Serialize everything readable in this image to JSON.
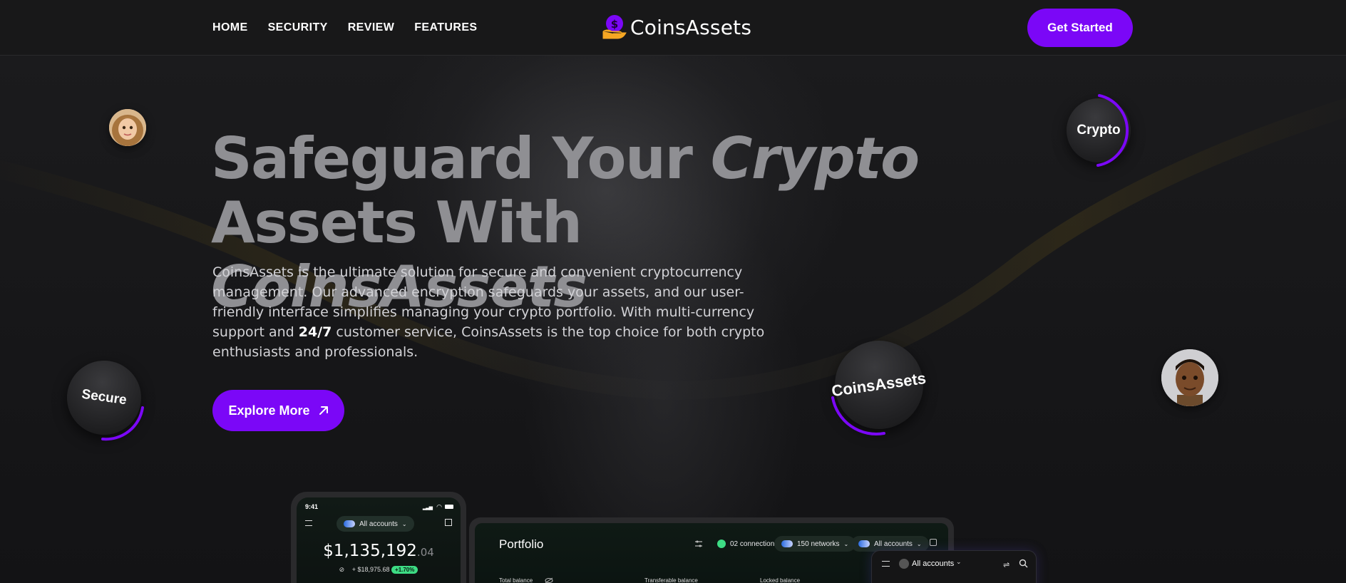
{
  "nav": {
    "items": [
      {
        "label": "HOME"
      },
      {
        "label": "SECURITY"
      },
      {
        "label": "REVIEW"
      },
      {
        "label": "FEATURES"
      }
    ]
  },
  "logo": {
    "text": "CoinsAssets",
    "icon": "coin-hand-icon"
  },
  "header": {
    "cta_label": "Get Started"
  },
  "hero": {
    "title_line1_plain": "Safeguard Your ",
    "title_line1_em": "Crypto",
    "title_line2_plain": "Assets With ",
    "title_line2_em": "CoinsAssets",
    "desc_part1": "CoinsAssets is the ultimate solution for secure and convenient cryptocurrency management. Our advanced encryption safeguards your assets, and our user-friendly interface simplifies managing your crypto portfolio. With multi-currency support and ",
    "desc_strong": "24/7",
    "desc_part2": " customer service, CoinsAssets is the top choice for both crypto enthusiasts and professionals.",
    "explore_label": "Explore More"
  },
  "bubbles": {
    "crypto": "Crypto",
    "secure": "Secure",
    "coinsassets": "CoinsAssets"
  },
  "phone": {
    "time": "9:41",
    "accounts_label": "All accounts",
    "balance_main": "$1,135,192",
    "balance_cents": ".04",
    "change": "+ $18,975.68",
    "change_pct": "+1.70%"
  },
  "desktop": {
    "title": "Portfolio",
    "connections": "02 connections",
    "networks": "150 networks",
    "accounts": "All accounts",
    "col_total": "Total balance",
    "col_transferable": "Transferable balance",
    "col_locked": "Locked balance"
  },
  "mini": {
    "accounts": "All accounts"
  },
  "colors": {
    "accent": "#7b07f7",
    "background": "#141416",
    "title_gray": "#8f8f93",
    "positive": "#3ddc84"
  }
}
